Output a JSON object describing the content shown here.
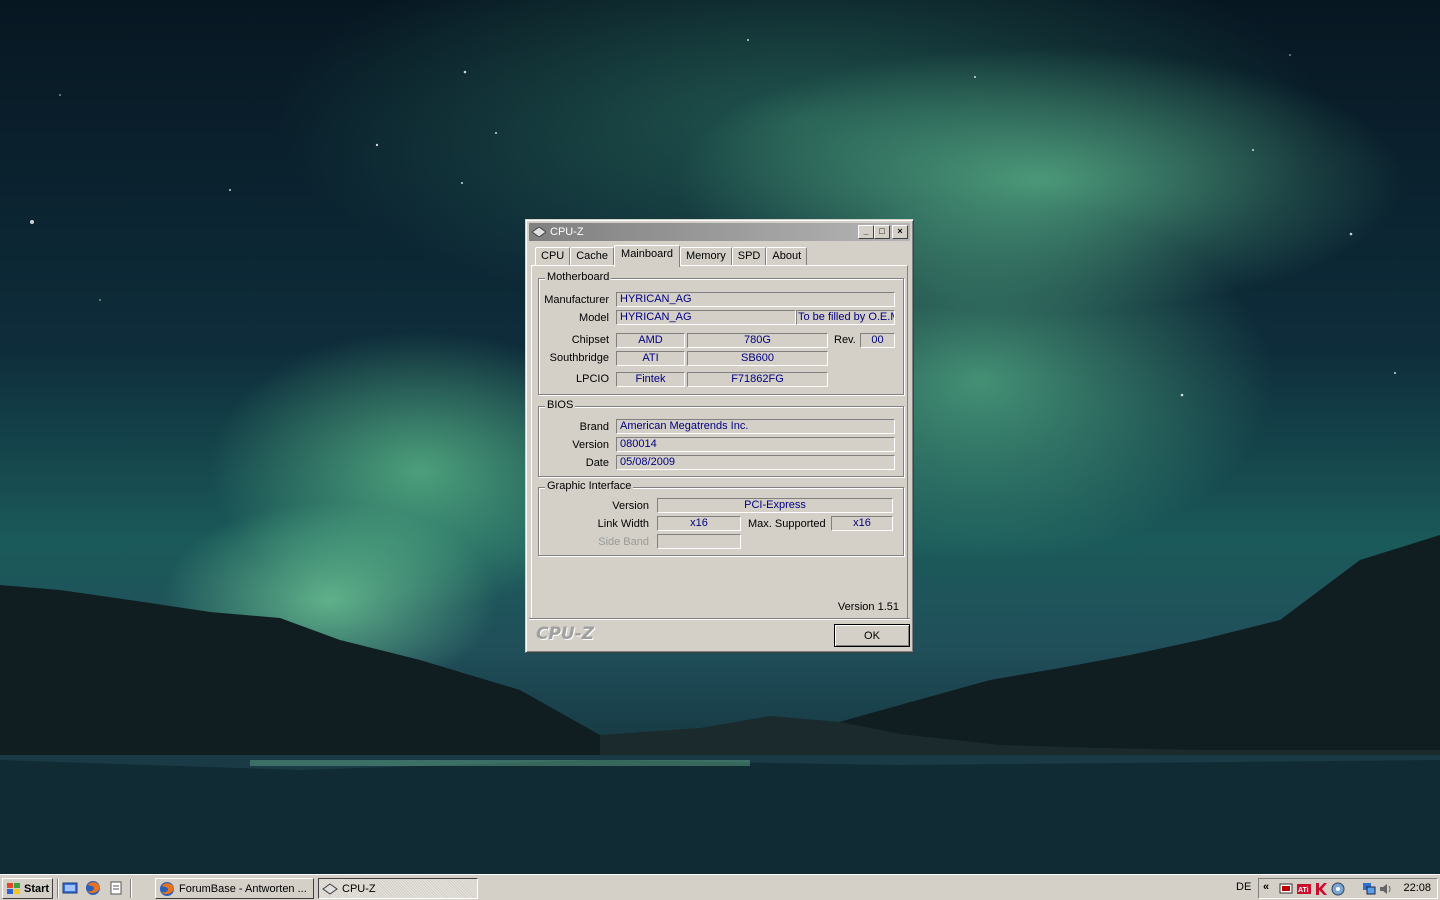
{
  "window": {
    "title": "CPU-Z",
    "tabs": [
      "CPU",
      "Cache",
      "Mainboard",
      "Memory",
      "SPD",
      "About"
    ],
    "active_tab": "Mainboard",
    "motherboard": {
      "title": "Motherboard",
      "manufacturer_label": "Manufacturer",
      "manufacturer": "HYRICAN_AG",
      "model_label": "Model",
      "model": "HYRICAN_AG",
      "model_extra": "To be filled by O.E.M",
      "chipset_label": "Chipset",
      "chipset_vendor": "AMD",
      "chipset_model": "780G",
      "rev_label": "Rev.",
      "rev": "00",
      "southbridge_label": "Southbridge",
      "southbridge_vendor": "ATI",
      "southbridge_model": "SB600",
      "lpcio_label": "LPCIO",
      "lpcio_vendor": "Fintek",
      "lpcio_model": "F71862FG"
    },
    "bios": {
      "title": "BIOS",
      "brand_label": "Brand",
      "brand": "American Megatrends Inc.",
      "version_label": "Version",
      "version": "080014",
      "date_label": "Date",
      "date": "05/08/2009"
    },
    "graphic": {
      "title": "Graphic Interface",
      "version_label": "Version",
      "version": "PCI-Express",
      "link_width_label": "Link Width",
      "link_width": "x16",
      "max_supported_label": "Max. Supported",
      "max_supported": "x16",
      "side_band_label": "Side Band",
      "side_band": ""
    },
    "version_text": "Version 1.51",
    "brand_logo": "CPU-Z",
    "ok_label": "OK"
  },
  "taskbar": {
    "start_label": "Start",
    "quick_launch_icons": [
      "show-desktop-icon",
      "firefox-icon",
      "notepad-icon"
    ],
    "tasks": [
      {
        "label": "ForumBase - Antworten ...",
        "icon": "firefox-icon"
      },
      {
        "label": "CPU-Z",
        "icon": "cpu-z-icon"
      }
    ],
    "active_task": "CPU-Z",
    "language": "DE",
    "tray_expand": "«",
    "tray_icons": [
      "display-icon",
      "ati-icon",
      "antivirus-icon",
      "network-tool-icon",
      "network-icon",
      "volume-icon"
    ],
    "clock": "22:08"
  },
  "colors": {
    "window_face": "#d4d0c8",
    "field_text": "#000080",
    "inactive_title": "#808080"
  }
}
